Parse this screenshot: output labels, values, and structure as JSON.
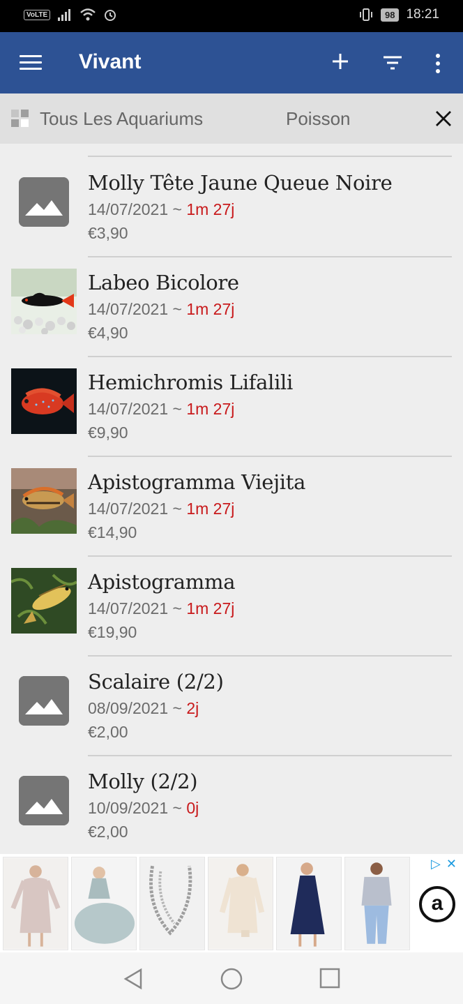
{
  "status_bar": {
    "volte": "VoLTE",
    "battery": "98",
    "time": "18:21"
  },
  "app_bar": {
    "title": "Vivant",
    "icons": [
      "menu-icon",
      "add-icon",
      "filter-icon",
      "more-vert-icon"
    ]
  },
  "filter_bar": {
    "aquarium": "Tous Les Aquariums",
    "category": "Poisson",
    "icons": [
      "grid-icon",
      "close-icon"
    ]
  },
  "items": [
    {
      "name": "Molly Tête Jaune Queue Noire",
      "date": "14/07/2021",
      "sep": " ~ ",
      "age": "1m 27j",
      "price": "€3,90",
      "image": "placeholder"
    },
    {
      "name": "Labeo Bicolore",
      "date": "14/07/2021",
      "sep": " ~ ",
      "age": "1m 27j",
      "price": "€4,90",
      "image": "labeo-photo"
    },
    {
      "name": "Hemichromis Lifalili",
      "date": "14/07/2021",
      "sep": " ~ ",
      "age": "1m 27j",
      "price": "€9,90",
      "image": "hemichromis-photo"
    },
    {
      "name": "Apistogramma Viejita",
      "date": "14/07/2021",
      "sep": " ~ ",
      "age": "1m 27j",
      "price": "€14,90",
      "image": "viejita-photo"
    },
    {
      "name": "Apistogramma",
      "date": "14/07/2021",
      "sep": " ~ ",
      "age": "1m 27j",
      "price": "€19,90",
      "image": "apistogramma-photo"
    },
    {
      "name": "Scalaire (2/2)",
      "date": "08/09/2021",
      "sep": " ~ ",
      "age": "2j",
      "price": "€2,00",
      "image": "placeholder"
    },
    {
      "name": "Molly (2/2)",
      "date": "10/09/2021",
      "sep": " ~ ",
      "age": "0j",
      "price": "€2,00",
      "image": "placeholder"
    }
  ],
  "ad": {
    "logo": "a",
    "products": [
      "sequin-dress",
      "tulle-gown",
      "chain-necklace",
      "lace-dress",
      "navy-dress",
      "denim-outfit"
    ]
  },
  "colors": {
    "app_bar": "#2d5294",
    "age_red": "#c8191b",
    "background": "#eeeeee"
  }
}
